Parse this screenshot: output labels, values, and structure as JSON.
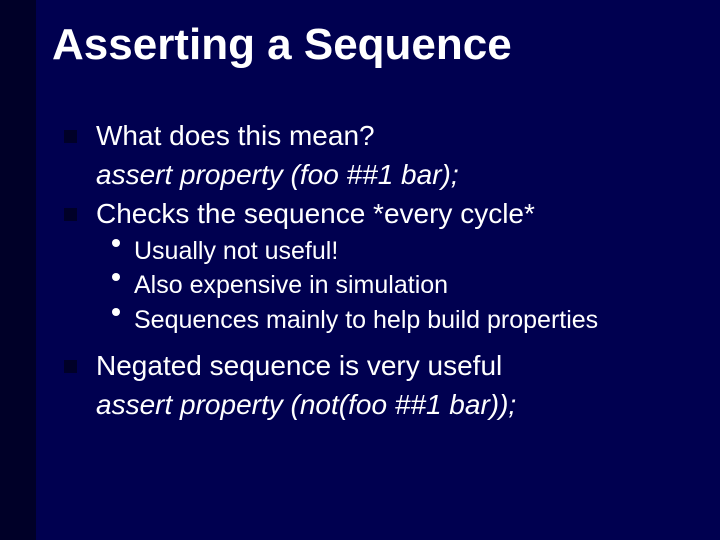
{
  "title": "Asserting a Sequence",
  "bullets": {
    "b1": "What does this mean?",
    "b1_code": "assert property (foo ##1 bar);",
    "b2": "Checks the sequence *every cycle*",
    "b2_sub1": "Usually not useful!",
    "b2_sub2": "Also expensive in simulation",
    "b2_sub3": "Sequences mainly to help build properties",
    "b3": "Negated sequence is very useful",
    "b3_code": "assert property (not(foo ##1 bar));"
  }
}
